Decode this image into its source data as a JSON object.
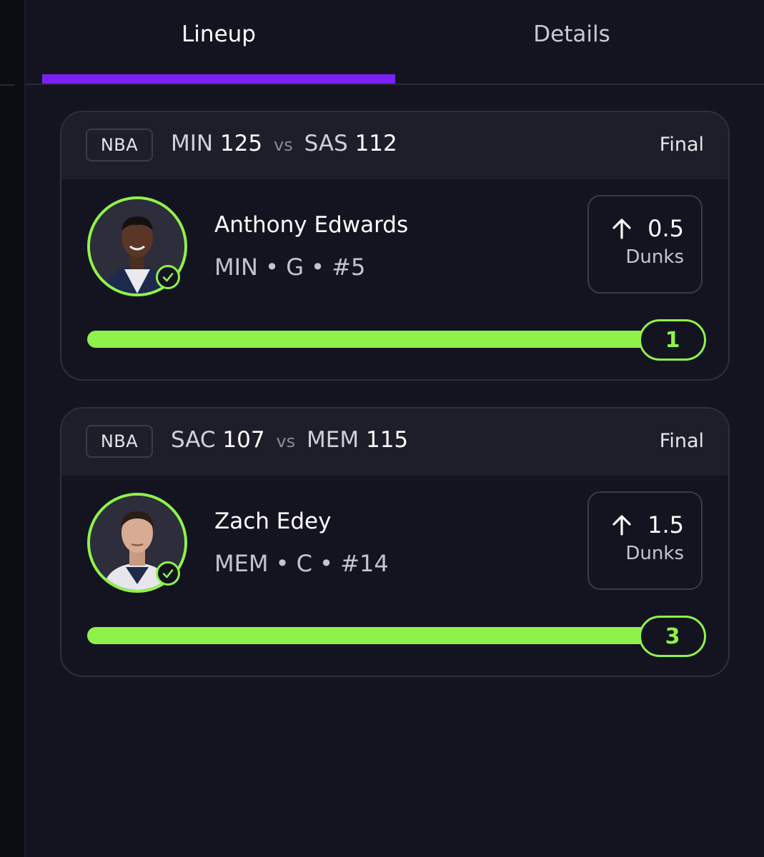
{
  "tabs": [
    {
      "label": "Lineup",
      "active": true
    },
    {
      "label": "Details",
      "active": false
    }
  ],
  "colors": {
    "accent": "#7a22f5",
    "success": "#8ff24a",
    "background": "#141421"
  },
  "cards": [
    {
      "league": "NBA",
      "away_team": "MIN",
      "away_score": "125",
      "vs": "vs",
      "home_team": "SAS",
      "home_score": "112",
      "status": "Final",
      "player": {
        "name": "Anthony Edwards",
        "meta": "MIN • G • #5",
        "avatar_icon": "player-headshot-icon",
        "check_icon": "checkmark-icon"
      },
      "projection": {
        "direction_icon": "arrow-up-icon",
        "line": "0.5",
        "stat": "Dunks"
      },
      "result": {
        "value": "1",
        "progress": 1.0
      }
    },
    {
      "league": "NBA",
      "away_team": "SAC",
      "away_score": "107",
      "vs": "vs",
      "home_team": "MEM",
      "home_score": "115",
      "status": "Final",
      "player": {
        "name": "Zach Edey",
        "meta": "MEM • C • #14",
        "avatar_icon": "player-headshot-icon",
        "check_icon": "checkmark-icon"
      },
      "projection": {
        "direction_icon": "arrow-up-icon",
        "line": "1.5",
        "stat": "Dunks"
      },
      "result": {
        "value": "3",
        "progress": 1.0
      }
    }
  ]
}
